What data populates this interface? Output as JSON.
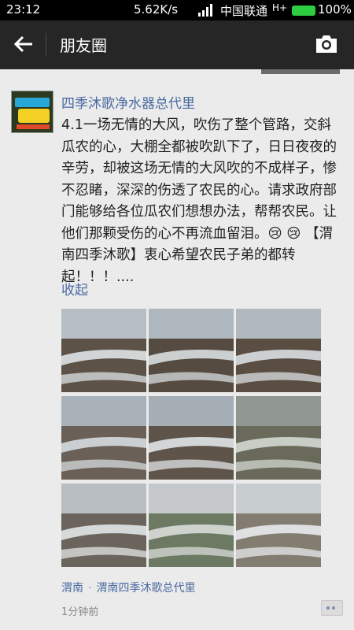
{
  "status_bar": {
    "time": "23:12",
    "speed": "5.62K/s",
    "carrier": "中国联通",
    "network": "H+",
    "battery": "100%"
  },
  "app_bar": {
    "title": "朋友圈",
    "back_icon": "arrow-left-icon",
    "camera_icon": "camera-icon"
  },
  "post": {
    "author": "四季沐歌净水器总代里",
    "text": "4.1一场无情的大风，吹伤了整个管路，交斜瓜农的心，大棚全都被吹趴下了，日日夜夜的辛劳，却被这场无情的大风吹的不成样子，惨不忍睹，深深的伤透了农民的心。请求政府部门能够给各位瓜农们想想办法，帮帮农民。让他们那颗受伤的心不再流血留泪。😢 😢 【渭南四季沐歌】衷心希望农民子弟的都转起！！！....",
    "collapse_label": "收起",
    "location": "渭南",
    "location_detail": "渭南四季沐歌总代里",
    "separator": "·",
    "time_ago": "1分钟前",
    "photos": [
      {
        "sky": "#b7bfc4",
        "ground": "#5d5247",
        "film": "#e6ecef"
      },
      {
        "sky": "#aeb7bd",
        "ground": "#564b40",
        "film": "#dfe6ea"
      },
      {
        "sky": "#b1b9bf",
        "ground": "#5a4e43",
        "film": "#e2e8ec"
      },
      {
        "sky": "#a9b2b9",
        "ground": "#6a6058",
        "film": "#dde3e6"
      },
      {
        "sky": "#a5aeb5",
        "ground": "#5e544a",
        "film": "#e8edf0"
      },
      {
        "sky": "#8f9790",
        "ground": "#6a6a5a",
        "film": "#d8ded9"
      },
      {
        "sky": "#b8bec2",
        "ground": "#6b645c",
        "film": "#e9edef"
      },
      {
        "sky": "#c4c8cb",
        "ground": "#6d7a63",
        "film": "#dfe3e1"
      },
      {
        "sky": "#c8cdd0",
        "ground": "#837c70",
        "film": "#eef2f4"
      }
    ]
  }
}
